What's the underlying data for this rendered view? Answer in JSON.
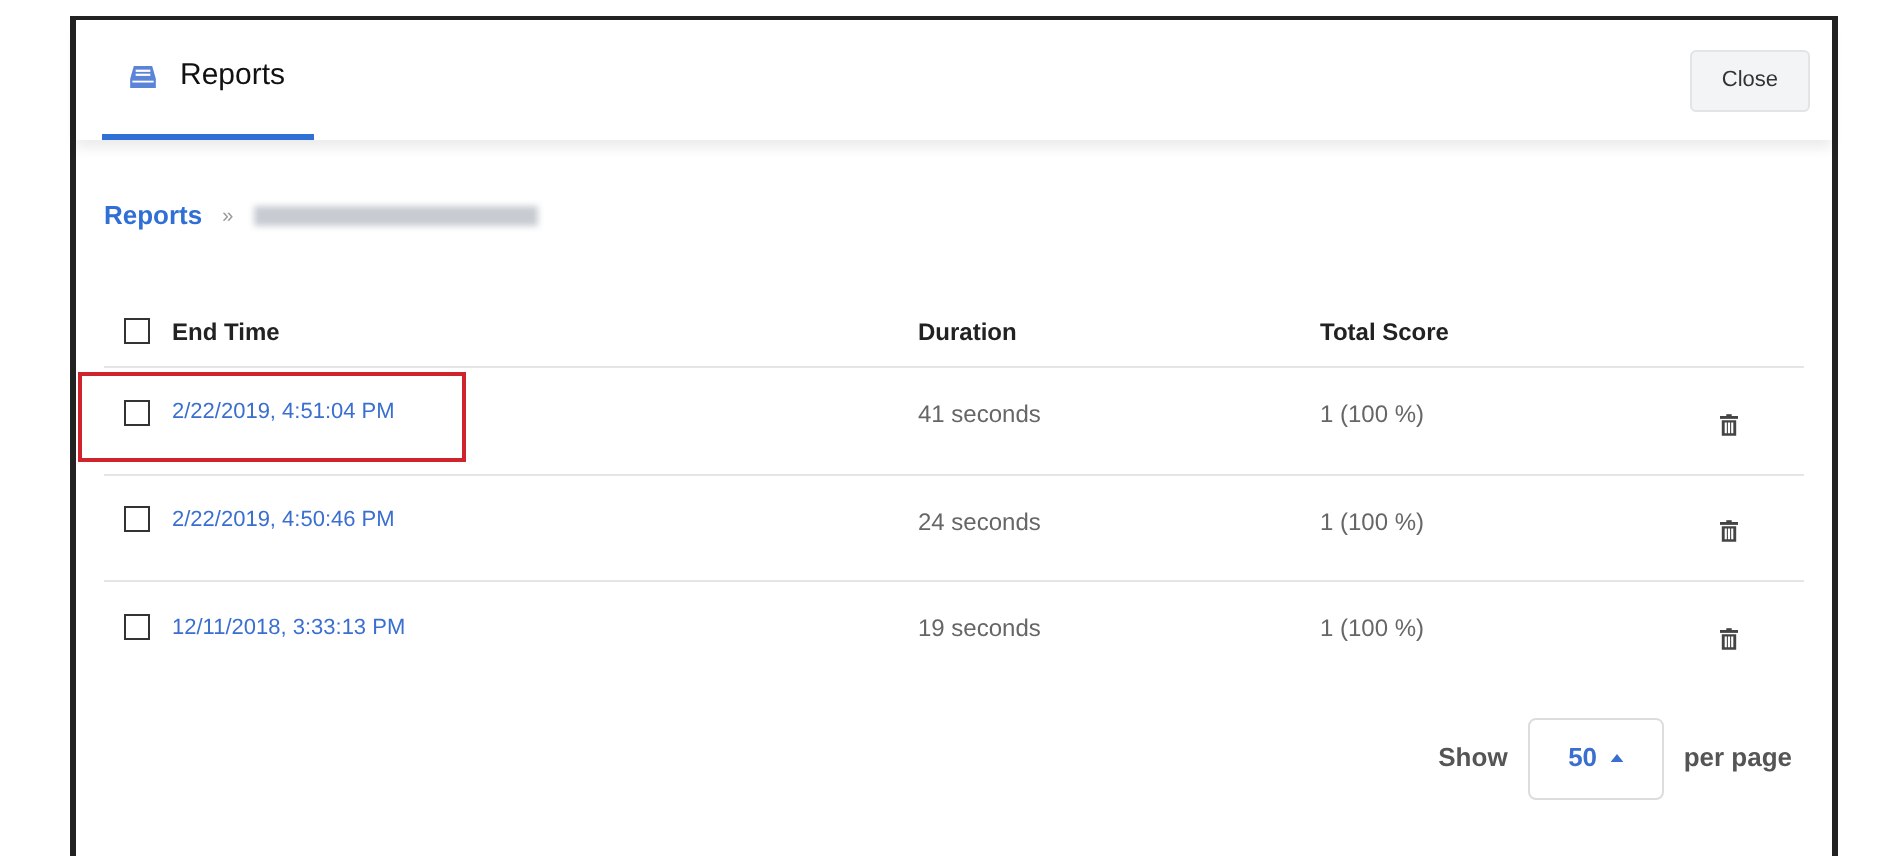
{
  "tabs": [
    {
      "label": "Reports",
      "selected": true
    }
  ],
  "close_button": "Close",
  "breadcrumb": {
    "link": "Reports",
    "separator": "»"
  },
  "table": {
    "columns": [
      "End Time",
      "Duration",
      "Total Score"
    ],
    "header_checked": false,
    "rows": [
      {
        "end_time": "2/22/2019, 4:51:04 PM",
        "duration": "41 seconds",
        "total_score": "1 (100 %)",
        "checked": false,
        "highlighted": true
      },
      {
        "end_time": "2/22/2019, 4:50:46 PM",
        "duration": "24 seconds",
        "total_score": "1 (100 %)",
        "checked": false,
        "highlighted": false
      },
      {
        "end_time": "12/11/2018, 3:33:13 PM",
        "duration": "19 seconds",
        "total_score": "1 (100 %)",
        "checked": false,
        "highlighted": false
      }
    ]
  },
  "pagination": {
    "show_label": "Show",
    "page_size": "50",
    "per_page_label": "per page"
  }
}
